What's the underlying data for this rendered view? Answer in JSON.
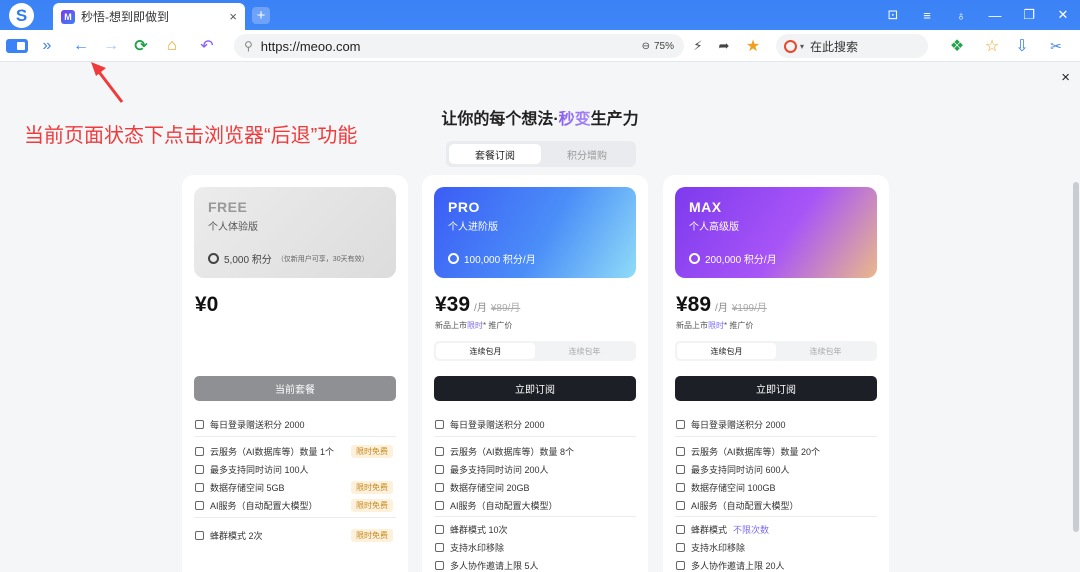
{
  "browser": {
    "logo_glyph": "S",
    "tab": {
      "favicon_glyph": "M",
      "title": "秒悟-想到即做到",
      "close": "×"
    },
    "new_tab": "+",
    "window_controls": [
      "⊡",
      "≡",
      "♁",
      "—",
      "❐",
      "✕"
    ],
    "nav": {
      "menu": "»",
      "back": "←",
      "forward": "→",
      "refresh": "⟳",
      "home": "⌂",
      "undo": "↶"
    },
    "url": "https://meoo.com",
    "zoom": "75%",
    "search_placeholder": "在此搜索"
  },
  "page": {
    "close": "×",
    "annotation": "当前页面状态下点击浏览器“后退”功能",
    "headline_pre": "让你的每个想法·",
    "headline_accent": "秒变",
    "headline_post": "生产力",
    "segments": [
      "套餐订阅",
      "积分增购"
    ],
    "billing_options": [
      "连续包月",
      "连续包年"
    ],
    "plans": [
      {
        "name": "FREE",
        "subtitle": "个人体验版",
        "credits": "5,000 积分",
        "credits_note": "（仅新用户可享，30天有效）",
        "price": "¥0",
        "per": "",
        "old_price": "",
        "promo": "",
        "cta": "当前套餐",
        "features": [
          {
            "text": "每日登录赠送积分 2000",
            "badge": ""
          },
          {
            "text": "云服务（AI数据库等）数量 1个",
            "badge": "限时免费"
          },
          {
            "text": "最多支持同时访问 100人",
            "badge": ""
          },
          {
            "text": "数据存储空间 5GB",
            "badge": "限时免费"
          },
          {
            "text": "AI服务（自动配置大模型）",
            "badge": "限时免费"
          },
          {
            "text": "蜂群模式 2次",
            "badge": "限时免费"
          }
        ]
      },
      {
        "name": "PRO",
        "subtitle": "个人进阶版",
        "credits": "100,000 积分/月",
        "credits_note": "",
        "price": "¥39",
        "per": "/月",
        "old_price": "¥89/月",
        "promo_pre": "新品上市",
        "promo_hl": "限时",
        "promo_post": "* 推广价",
        "cta": "立即订阅",
        "features": [
          {
            "text": "每日登录赠送积分 2000",
            "badge": ""
          },
          {
            "text": "云服务（AI数据库等）数量 8个",
            "badge": ""
          },
          {
            "text": "最多支持同时访问 200人",
            "badge": ""
          },
          {
            "text": "数据存储空间 20GB",
            "badge": ""
          },
          {
            "text": "AI服务（自动配置大模型）",
            "badge": ""
          },
          {
            "text": "蜂群模式 10次",
            "badge": ""
          },
          {
            "text": "支持水印移除",
            "badge": ""
          },
          {
            "text": "多人协作邀请上限 5人",
            "badge": ""
          }
        ]
      },
      {
        "name": "MAX",
        "subtitle": "个人高级版",
        "credits": "200,000 积分/月",
        "credits_note": "",
        "price": "¥89",
        "per": "/月",
        "old_price": "¥199/月",
        "promo_pre": "新品上市",
        "promo_hl": "限时",
        "promo_post": "* 推广价",
        "cta": "立即订阅",
        "features": [
          {
            "text": "每日登录赠送积分 2000",
            "badge": ""
          },
          {
            "text": "云服务（AI数据库等）数量 20个",
            "badge": ""
          },
          {
            "text": "最多支持同时访问 600人",
            "badge": ""
          },
          {
            "text": "数据存储空间 100GB",
            "badge": ""
          },
          {
            "text": "AI服务（自动配置大模型）",
            "badge": ""
          },
          {
            "text": "蜂群模式",
            "badge": ""
          },
          {
            "text": "不限次数",
            "badge": ""
          },
          {
            "text": "支持水印移除",
            "badge": ""
          },
          {
            "text": "多人协作邀请上限 20人",
            "badge": ""
          }
        ]
      }
    ]
  },
  "colors": {
    "browser_blue": "#3b82f6",
    "annotation_red": "#ef3b3b",
    "accent_purple": "#7c6cf2",
    "cta_dark": "#1c1f26",
    "cta_disabled": "#8e9094",
    "badge_bg": "#fdf1dc",
    "badge_fg": "#c6871a"
  }
}
